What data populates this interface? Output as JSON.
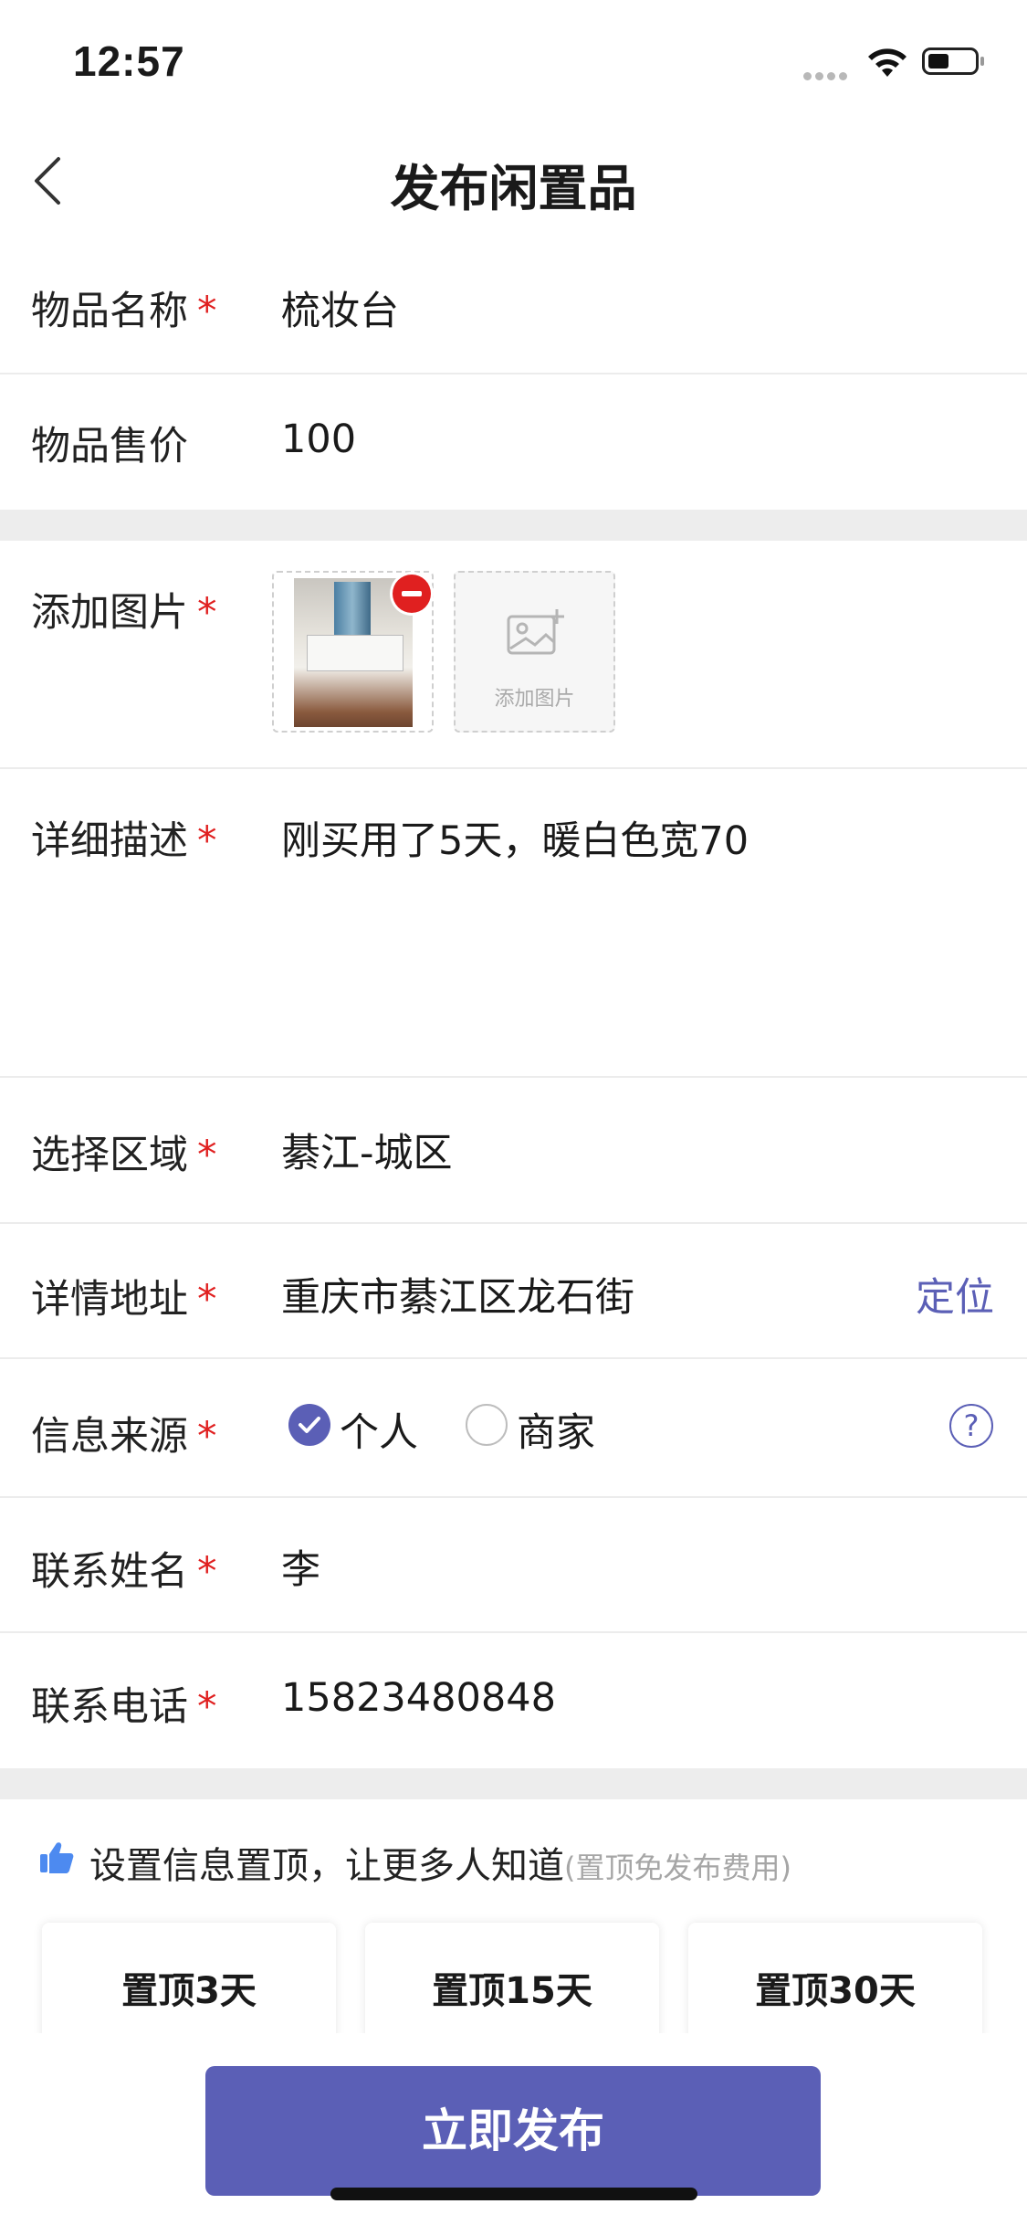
{
  "status": {
    "time": "12:57"
  },
  "nav": {
    "title": "发布闲置品"
  },
  "form": {
    "name_label": "物品名称",
    "name_value": "梳妆台",
    "price_label": "物品售价",
    "price_value": "100",
    "images_label": "添加图片",
    "add_image_label": "添加图片",
    "desc_label": "详细描述",
    "desc_value": "刚买用了5天，暖白色宽70",
    "area_label": "选择区域",
    "area_value": "綦江-城区",
    "address_label": "详情地址",
    "address_value": "重庆市綦江区龙石街",
    "locate_label": "定位",
    "source_label": "信息来源",
    "source_options": [
      "个人",
      "商家"
    ],
    "source_selected": "个人",
    "contact_name_label": "联系姓名",
    "contact_name_value": "李",
    "phone_label": "联系电话",
    "phone_value": "15823480848",
    "required_mark": "*",
    "help_mark": "?"
  },
  "promo": {
    "title": "设置信息置顶，让更多人知道",
    "hint": "(置顶免发布费用)",
    "options": [
      "置顶3天",
      "置顶15天",
      "置顶30天"
    ]
  },
  "actions": {
    "publish": "立即发布"
  },
  "colors": {
    "accent": "#5b5fb6",
    "required": "#e02020",
    "divider": "#ececec"
  }
}
